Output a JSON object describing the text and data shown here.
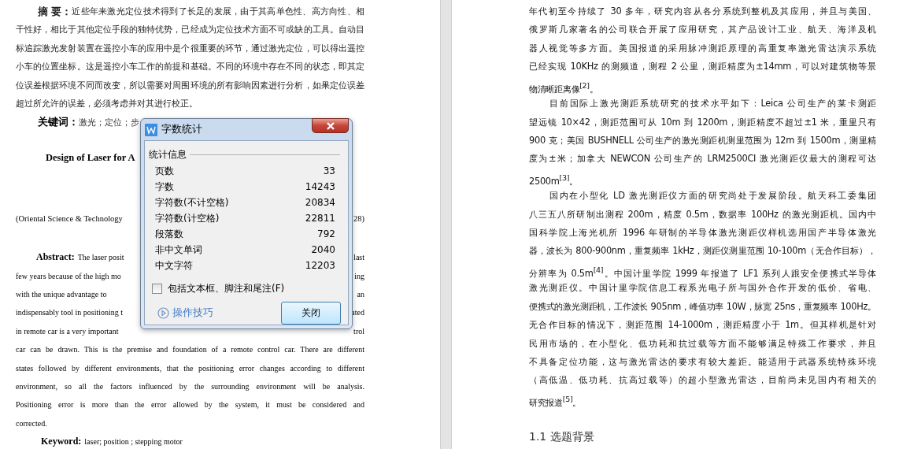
{
  "left_page": {
    "abstract": {
      "label": "摘 要：",
      "lines": [
        "近些年来激光定位技术得到了长足的发展，由于其高单色性、高方向性、相",
        "干性好，相比于其他定位手段的独特优势，已经成为定位技术方面不可或缺的工具。自动目",
        "标追踪激光发射装置在遥控小车的应用中是个很重要的环节，通过激光定位，可以得出遥控",
        "小车的位置坐标。这是遥控小车工作的前提和基础。不同的环境中存在不同的状态，即其定",
        "位误差根据环境不同而改变，所以需要对周围环境的所有影响因素进行分析，如果定位误差",
        "超过所允许的误差，必须考虑并对其进行校正。"
      ]
    },
    "keywords": {
      "label": "关键词：",
      "text": "激光；定位；步"
    },
    "en_title": "Design of Laser for A",
    "affiliation": {
      "left": "(Oriental Science  & Technology",
      "right": "28)"
    },
    "en_abstract": {
      "label": "Abstract:",
      "lines": [
        {
          "left": "The laser posit",
          "right": "last"
        },
        {
          "left": "few years because of the high mo",
          "right": "ing"
        },
        {
          "left": "with the unique advantage to",
          "right": "an"
        },
        {
          "left": "indispensably tool in positioning t",
          "right": "ated"
        },
        {
          "left": "in remote car is a very important",
          "right": "trol"
        },
        {
          "left": "car can be drawn. This is the premise and foundation of a remote control car. There are different"
        },
        {
          "left": "states followed by different environments, that the positioning error changes according to different"
        },
        {
          "left": "environment, so all the factors influenced by the surrounding environment will be analysis."
        },
        {
          "left": "Positioning error is more than the error allowed by the system, it must be considered and"
        },
        {
          "left": "corrected."
        }
      ]
    },
    "en_keyword": {
      "label": "Keyword:",
      "text": "laser;  position ;  stepping motor"
    }
  },
  "right_page": {
    "paragraphs": [
      {
        "continued": true,
        "lines": [
          "年代初至今持续了 30 多年，研究内容从各分系统到整机及其应用，并且与美国、",
          "俄罗斯几家著名的公司联合开展了应用研究，其产品设计工业、航天、海洋及机",
          "器人视觉等多方面。美国报道的采用脉冲测距原理的高重复率激光雷达演示系统",
          "已经实现 10KHz 的测频道，测程 2 公里，测距精度为±14mm，可以对建筑物等景",
          "物清晰距离像$^{[2]}$。"
        ]
      },
      {
        "continued": false,
        "lines": [
          "目前国际上激光测距系统研究的技术水平如下：Leica 公司生产的莱卡测距",
          "望远镜 10×42，测距范围可从 10m 到 1200m，测距精度不超过±1 米，重里只有",
          "900 克；美国 BUSHNELL 公司生产的激光测距机测里范围为 12m 到 1500m，测里精",
          "度为±米；加拿大 NEWCON 公司生产的 LRM2500CI 激光测距仪最大的测程可达",
          "2500m$^{[3]}$。"
        ]
      },
      {
        "continued": false,
        "lines": [
          "国内在小型化 LD 激光测距仪方面的研究尚处于发展阶段。航天科工委集团",
          "八三五八所研制出测程 200m，精度 0.5m，数据率 100Hz 的激光测距机。国内中",
          "国科学院上海光机所 1996 年研制的半导体激光测距仪样机选用国产半导体激光",
          "器，波长为 800-900nm，重复频率 1kHz，测距仪测里范围 10-100m（无合作目标），",
          "分辨率为 0.5m$^{[4]}$。中国计里学院 1999 年报道了 LF1 系列人跟安全便携式半导体",
          "激光测距仪。中国计里学院信息工程系光电子所与国外合作开发的低价、省电、",
          "便携式的激光测距机，工作波长 905nm，峰值功率 10W，脉宽 25ns，重复频率 100Hz。",
          "无合作目标的情况下，测距范围 14-1000m，测距精度小于 1m。但其样机是针对",
          "民用市场的，在小型化、低功耗和抗过载等方面不能够满足特殊工作要求，并且",
          "不具备定位功能，这与激光雷达的要求有较大差距。能适用于武器系统特殊环境",
          "（高低温、低功耗、抗高过载等）的超小型激光雷达，目前尚未见国内有相关的",
          "研究报道$^{[5]}$。"
        ]
      }
    ],
    "heading": "1.1 选题背景"
  },
  "dialog": {
    "title": "字数统计",
    "group": "统计信息",
    "stats": [
      {
        "label": "页数",
        "value": "33"
      },
      {
        "label": "字数",
        "value": "14243"
      },
      {
        "label": "字符数(不计空格)",
        "value": "20834"
      },
      {
        "label": "字符数(计空格)",
        "value": "22811"
      },
      {
        "label": "段落数",
        "value": "792"
      },
      {
        "label": "非中文单词",
        "value": "2040"
      },
      {
        "label": "中文字符",
        "value": "12203"
      }
    ],
    "checkbox": {
      "label": "包括文本框、脚注和尾注(F)",
      "checked": false
    },
    "tips_link": "操作技巧",
    "close_button": "关闭"
  }
}
